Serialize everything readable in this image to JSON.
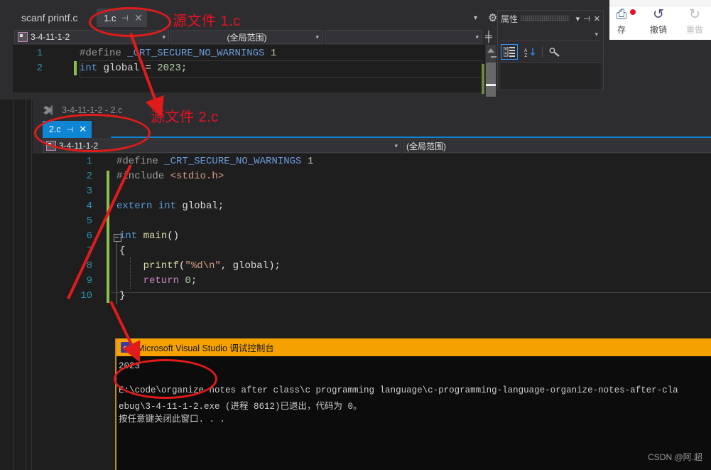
{
  "window1": {
    "tabs": [
      {
        "label": "scanf printf.c",
        "active": false
      },
      {
        "label": "1.c",
        "active": true,
        "pin": "⊣",
        "close": "✕"
      }
    ],
    "navbar": {
      "project": "3-4-11-1-2",
      "scope": "(全局范围)",
      "member": ""
    },
    "code": [
      {
        "num": "1",
        "tokens": [
          {
            "t": "#define ",
            "c": "cm-pre"
          },
          {
            "t": "_CRT_SECURE_NO_WARNINGS",
            "c": "cm-mac"
          },
          {
            "t": " 1",
            "c": "cm-num"
          }
        ]
      },
      {
        "num": "2",
        "tokens": [
          {
            "t": "int",
            "c": "cm-key"
          },
          {
            "t": " global ",
            "c": "cm-id"
          },
          {
            "t": "= ",
            "c": "cm-punct"
          },
          {
            "t": "2023",
            "c": "cm-num"
          },
          {
            "t": ";",
            "c": "cm-punct"
          }
        ]
      }
    ],
    "gear_icon": "⚙",
    "chevron_icon": "▾"
  },
  "properties": {
    "title": "属性",
    "collapse_icon": "▾",
    "pin_icon": "⊣",
    "close_icon": "✕",
    "dropdown_carat": "▾",
    "tools": [
      "categorized-icon",
      "alphabetical-sort-icon",
      "property-pages-icon"
    ]
  },
  "ribbon": {
    "items": [
      {
        "glyph": "⎙",
        "caption": "存",
        "disabled": false,
        "name": "save-all-button"
      },
      {
        "glyph": "↺",
        "caption": "撤销",
        "disabled": false,
        "name": "undo-button"
      },
      {
        "glyph": "↻",
        "caption": "重做",
        "disabled": true,
        "name": "redo-button"
      }
    ]
  },
  "window2": {
    "title": "3-4-11-1-2 - 2.c",
    "tab": {
      "label": "2.c",
      "pin": "⊣",
      "close": "✕"
    },
    "navbar": {
      "project": "3-4-11-1-2",
      "scope": "(全局范围)"
    },
    "code": [
      {
        "num": "1",
        "tokens": [
          {
            "t": "#define ",
            "c": "cm-pre"
          },
          {
            "t": "_CRT_SECURE_NO_WARNINGS",
            "c": "cm-mac"
          },
          {
            "t": " 1",
            "c": "cm-num"
          }
        ]
      },
      {
        "num": "2",
        "tokens": [
          {
            "t": "#include ",
            "c": "cm-pre"
          },
          {
            "t": "<stdio.h>",
            "c": "cm-str"
          }
        ]
      },
      {
        "num": "3",
        "tokens": []
      },
      {
        "num": "4",
        "tokens": [
          {
            "t": "extern ",
            "c": "cm-key"
          },
          {
            "t": "int ",
            "c": "cm-key"
          },
          {
            "t": "global",
            "c": "cm-id"
          },
          {
            "t": ";",
            "c": "cm-punct"
          }
        ]
      },
      {
        "num": "5",
        "tokens": []
      },
      {
        "num": "6",
        "tokens": [
          {
            "t": "int ",
            "c": "cm-key"
          },
          {
            "t": "main",
            "c": "cm-fn"
          },
          {
            "t": "()",
            "c": "cm-punct"
          }
        ]
      },
      {
        "num": "7",
        "tokens": [
          {
            "t": "{",
            "c": "cm-punct"
          }
        ]
      },
      {
        "num": "8",
        "tokens": [
          {
            "t": "    printf",
            "c": "cm-fn"
          },
          {
            "t": "(",
            "c": "cm-punct"
          },
          {
            "t": "\"%d\\n\"",
            "c": "cm-str"
          },
          {
            "t": ", global",
            "c": "cm-id"
          },
          {
            "t": ");",
            "c": "cm-punct"
          }
        ]
      },
      {
        "num": "9",
        "tokens": [
          {
            "t": "    return ",
            "c": "cm-pink"
          },
          {
            "t": "0",
            "c": "cm-num"
          },
          {
            "t": ";",
            "c": "cm-punct"
          }
        ]
      },
      {
        "num": "10",
        "tokens": [
          {
            "t": "}",
            "c": "cm-punct"
          }
        ]
      }
    ]
  },
  "console": {
    "title": "Microsoft Visual Studio 调试控制台",
    "icon_letter": "c.",
    "lines": [
      "2023",
      "",
      "E:\\code\\organize notes after class\\c programming language\\c-programming-language-organize-notes-after-cla",
      "ebug\\3-4-11-1-2.exe (进程 8612)已退出，代码为 0。",
      "按任意键关闭此窗口. . ."
    ]
  },
  "annotations": {
    "label1": "源文件 1.c",
    "label2": "源文件 2.c",
    "accent_color": "#e81123"
  },
  "watermark": "CSDN @阿.超"
}
